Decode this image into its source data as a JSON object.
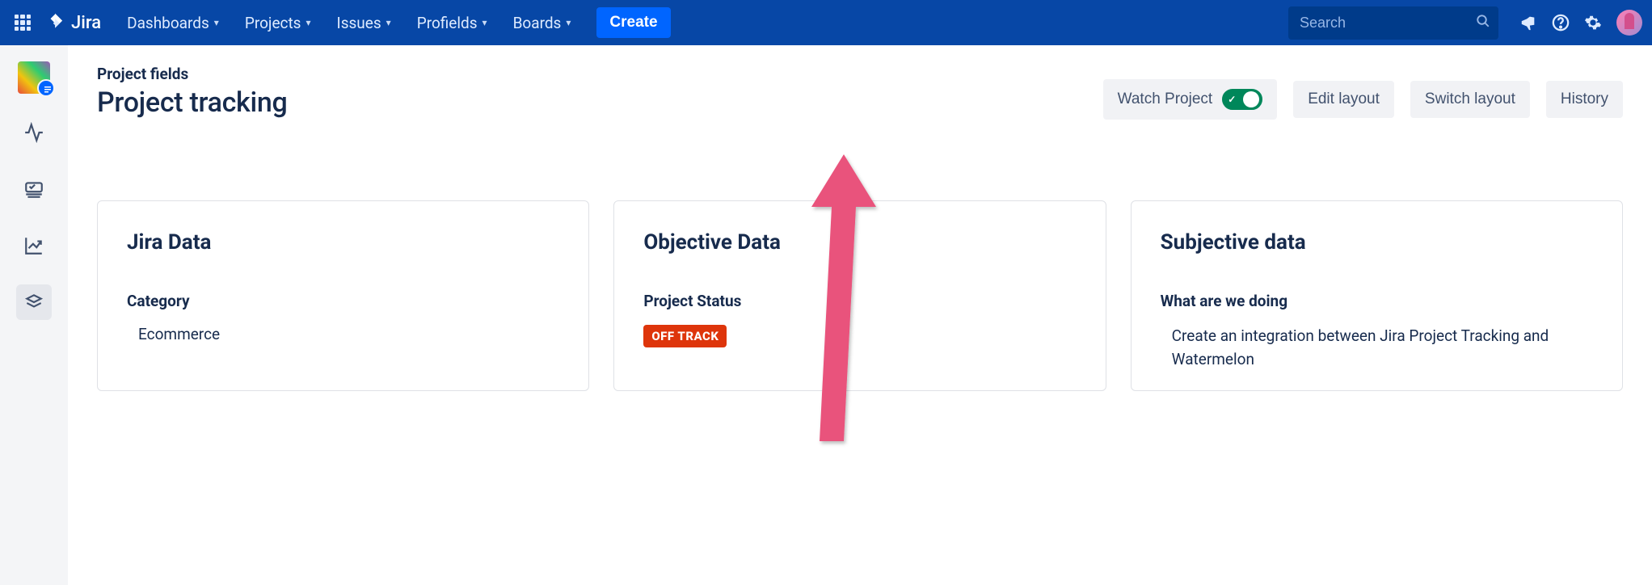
{
  "topnav": {
    "logo": "Jira",
    "items": [
      "Dashboards",
      "Projects",
      "Issues",
      "Profields",
      "Boards"
    ],
    "create_label": "Create",
    "search_placeholder": "Search"
  },
  "header": {
    "breadcrumb": "Project fields",
    "title": "Project tracking",
    "watch_label": "Watch Project",
    "watch_on": true,
    "edit_layout_label": "Edit layout",
    "switch_layout_label": "Switch layout",
    "history_label": "History"
  },
  "cards": [
    {
      "title": "Jira Data",
      "field_label": "Category",
      "value": "Ecommerce"
    },
    {
      "title": "Objective Data",
      "field_label": "Project Status",
      "status_badge": "OFF TRACK"
    },
    {
      "title": "Subjective data",
      "field_label": "What are we doing",
      "body": "Create an integration between Jira Project Tracking and Watermelon"
    }
  ]
}
